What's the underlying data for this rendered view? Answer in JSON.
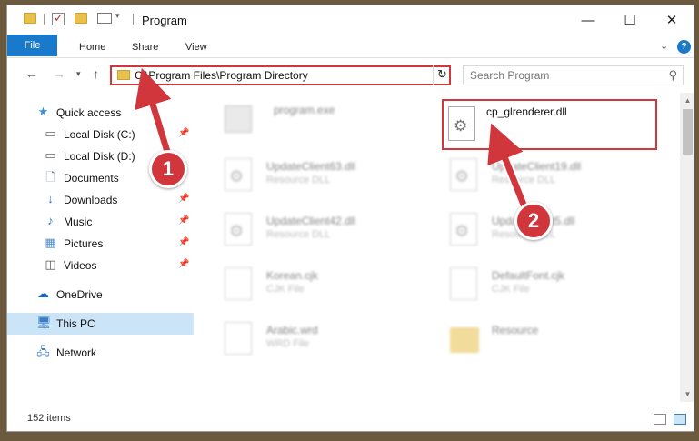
{
  "window": {
    "title": "Program"
  },
  "ribbon": {
    "tabs": [
      "File",
      "Home",
      "Share",
      "View"
    ]
  },
  "address": {
    "path": "C:\\Program Files\\Program Directory"
  },
  "search": {
    "placeholder": "Search Program"
  },
  "nav_pane": {
    "items": [
      {
        "label": "Quick access",
        "icon": "star-icon",
        "pinned": false
      },
      {
        "label": "Local Disk (C:)",
        "icon": "drive-icon",
        "pinned": true
      },
      {
        "label": "Local Disk (D:)",
        "icon": "drive-icon",
        "pinned": true
      },
      {
        "label": "Documents",
        "icon": "documents-icon",
        "pinned": true
      },
      {
        "label": "Downloads",
        "icon": "download-icon",
        "pinned": true
      },
      {
        "label": "Music",
        "icon": "music-icon",
        "pinned": true
      },
      {
        "label": "Pictures",
        "icon": "pictures-icon",
        "pinned": true
      },
      {
        "label": "Videos",
        "icon": "videos-icon",
        "pinned": true
      },
      {
        "label": "OneDrive",
        "icon": "cloud-icon",
        "pinned": false
      },
      {
        "label": "This PC",
        "icon": "computer-icon",
        "pinned": false,
        "selected": true
      },
      {
        "label": "Network",
        "icon": "network-icon",
        "pinned": false
      }
    ]
  },
  "files": [
    {
      "name": "program.exe",
      "type": "",
      "icon": "exe-icon"
    },
    {
      "name": "cp_glrenderer.dll",
      "type": "",
      "icon": "dll-gear-icon",
      "highlighted": true
    },
    {
      "name": "UpdateClient63.dll",
      "type": "Resource DLL",
      "icon": "dll-gear-icon"
    },
    {
      "name": "UpdateClient19.dll",
      "type": "Resource DLL",
      "icon": "dll-gear-icon"
    },
    {
      "name": "UpdateClient42.dll",
      "type": "Resource DLL",
      "icon": "dll-gear-icon"
    },
    {
      "name": "UpdateClient5.dll",
      "type": "Resource DLL",
      "icon": "dll-gear-icon"
    },
    {
      "name": "Korean.cjk",
      "type": "CJK File",
      "icon": "file-icon"
    },
    {
      "name": "DefaultFont.cjk",
      "type": "CJK File",
      "icon": "file-icon"
    },
    {
      "name": "Arabic.wrd",
      "type": "WRD File",
      "icon": "file-icon"
    },
    {
      "name": "Resource",
      "type": "",
      "icon": "folder-icon"
    }
  ],
  "status": {
    "item_count": "152 items"
  },
  "annotations": {
    "step1": "1",
    "step2": "2",
    "highlight_color": "#d1363c"
  },
  "colors": {
    "accent": "#1979ca",
    "selection": "#cce4f7"
  }
}
